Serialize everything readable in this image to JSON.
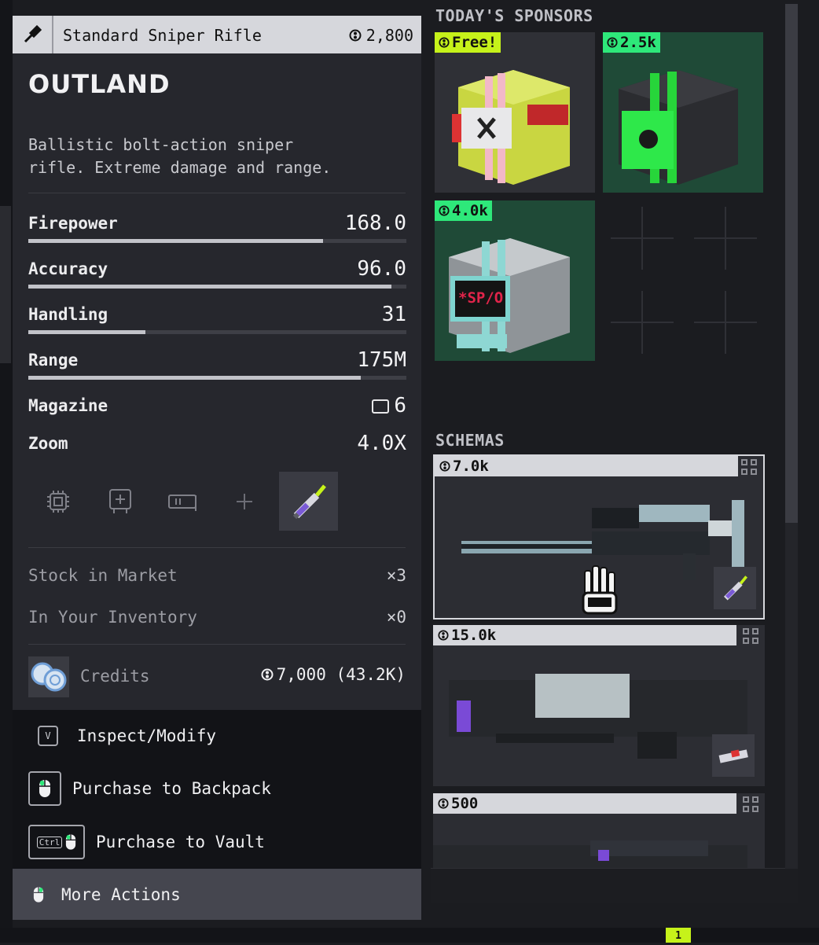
{
  "header": {
    "weapon_name": "Standard Sniper Rifle",
    "price": "2,800"
  },
  "item": {
    "title": "OUTLAND",
    "description_line1": "Ballistic bolt-action sniper",
    "description_line2": "rifle. Extreme damage and range."
  },
  "stats": {
    "firepower": {
      "label": "Firepower",
      "value": "168.0",
      "fill": 0.78
    },
    "accuracy": {
      "label": "Accuracy",
      "value": "96.0",
      "fill": 0.96
    },
    "handling": {
      "label": "Handling",
      "value": "31",
      "fill": 0.31
    },
    "range": {
      "label": "Range",
      "value": "175M",
      "fill": 0.88
    },
    "magazine": {
      "label": "Magazine",
      "value": "6"
    },
    "zoom": {
      "label": "Zoom",
      "value": "4.0X"
    }
  },
  "attachments": {
    "icons": [
      "chip-icon",
      "optic-icon",
      "barrel-icon",
      "add-icon",
      "syringe-icon"
    ],
    "selected": "syringe-icon"
  },
  "inventory": {
    "stock_label": "Stock in Market",
    "stock_value": "×3",
    "owned_label": "In Your Inventory",
    "owned_value": "×0",
    "credits_label": "Credits",
    "credits_value": "7,000 (43.2K)"
  },
  "actions": {
    "inspect_key": "V",
    "inspect": "Inspect/Modify",
    "purchase_backpack": "Purchase to Backpack",
    "vault_key": "Ctrl",
    "purchase_vault": "Purchase to Vault",
    "more": "More Actions"
  },
  "sponsors": {
    "section_label": "TODAY'S SPONSORS",
    "items": [
      {
        "tag": "Free!",
        "tag_color": "#c6f21a",
        "bg": "#2f3036"
      },
      {
        "tag": "2.5k",
        "tag_color": "#2ee87a",
        "bg": "#1f4a37"
      },
      {
        "tag": "4.0k",
        "tag_color": "#2ee87a",
        "bg": "#1f4a37",
        "crate_label": "*SP/O"
      }
    ]
  },
  "schemas": {
    "section_label": "SCHEMAS",
    "items": [
      {
        "price": "7.0k"
      },
      {
        "price": "15.0k"
      },
      {
        "price": "500"
      }
    ]
  },
  "hotbar": {
    "slot_number": "1"
  },
  "colors": {
    "accent_lime": "#c6f21a",
    "accent_green": "#2ee87a",
    "panel": "#26272d"
  }
}
